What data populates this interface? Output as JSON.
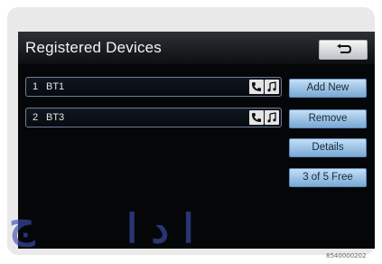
{
  "header": {
    "title": "Registered Devices",
    "back_icon": "return-arrow-icon"
  },
  "devices": [
    {
      "number": "1",
      "name": "BT1",
      "icons": [
        "phone-icon",
        "music-note-icon"
      ]
    },
    {
      "number": "2",
      "name": "BT3",
      "icons": [
        "phone-icon",
        "music-note-icon"
      ]
    }
  ],
  "actions": {
    "add_new": "Add New",
    "remove": "Remove",
    "details": "Details",
    "free_slots": "3 of 5 Free"
  },
  "watermark": {
    "left": "ج",
    "right": "ا د ا"
  },
  "image_code": "8540000202",
  "colors": {
    "screen_bg": "#050608",
    "button_blue": "#a9cff0",
    "row_border": "#6b7f98",
    "watermark": "#3c4fb0"
  }
}
